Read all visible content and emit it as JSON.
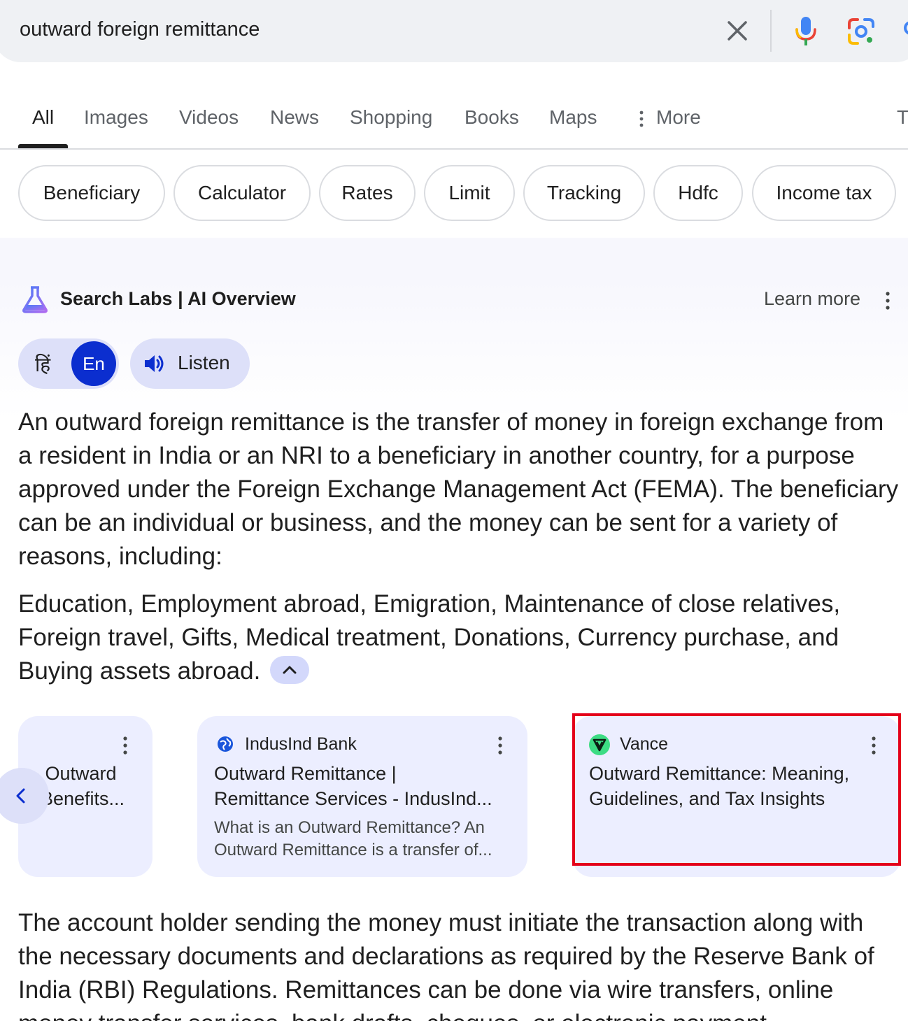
{
  "search": {
    "query": "outward foreign remittance",
    "icons": [
      "close-icon",
      "mic-icon",
      "google-lens-icon",
      "search-icon"
    ]
  },
  "tabs": {
    "items": [
      "All",
      "Images",
      "Videos",
      "News",
      "Shopping",
      "Books",
      "Maps",
      "More"
    ],
    "active": "All",
    "edge_label": "T"
  },
  "chips": [
    "Beneficiary",
    "Calculator",
    "Rates",
    "Limit",
    "Tracking",
    "Hdfc",
    "Income tax"
  ],
  "ai_overview": {
    "title": "Search Labs | AI Overview",
    "learn_more": "Learn more",
    "lang_hi": "हिं",
    "lang_en": "En",
    "listen": "Listen",
    "paragraph1": "An outward foreign remittance is the transfer of money in foreign exchange from a resident in India or an NRI to a beneficiary in another country, for a purpose approved under the Foreign Exchange Management Act (FEMA). The beneficiary can be an individual or business, and the money can be sent for a variety of reasons, including:",
    "paragraph2": "Education, Employment abroad, Emigration, Maintenance of close relatives, Foreign travel, Gifts, Medical treatment, Donations, Currency purchase, and Buying assets abroad.",
    "paragraph3": "The account holder sending the money must initiate the transaction along with the necessary documents and declarations as required by the Reserve Bank of India (RBI) Regulations. Remittances can be done via wire transfers, online money transfer services, bank drafts, cheques, or electronic payment"
  },
  "cards": [
    {
      "source": "",
      "title_line1": "- Outward",
      "title_line2": "Benefits...",
      "snippet": ""
    },
    {
      "source": "IndusInd Bank",
      "title_line1": "Outward Remittance |",
      "title_line2": "Remittance Services - IndusInd...",
      "snippet_line1": "What is an Outward Remittance? An",
      "snippet_line2": "Outward Remittance is a transfer of..."
    },
    {
      "source": "Vance",
      "title_line1": "Outward Remittance: Meaning,",
      "title_line2": "Guidelines, and Tax Insights"
    }
  ],
  "colors": {
    "accent_blue": "#0b2ecf",
    "highlight_red": "#e4001b",
    "card_bg": "#eceeff",
    "vance_green": "#3ddc84"
  }
}
